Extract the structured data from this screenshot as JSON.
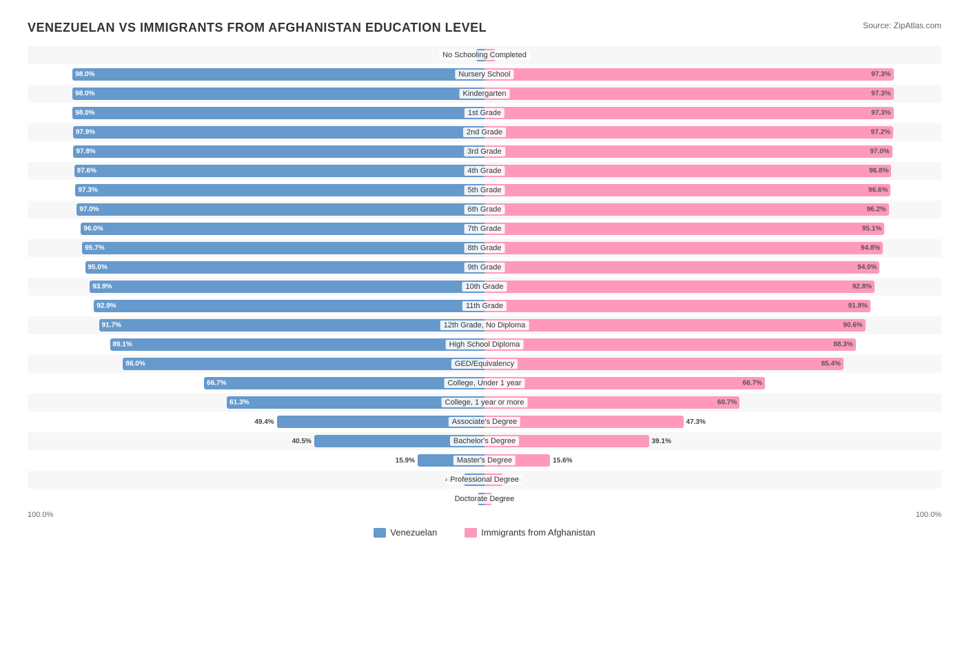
{
  "title": "VENEZUELAN VS IMMIGRANTS FROM AFGHANISTAN EDUCATION LEVEL",
  "source": "Source: ZipAtlas.com",
  "legend": {
    "blue_label": "Venezuelan",
    "pink_label": "Immigrants from Afghanistan"
  },
  "bottom_left": "100.0%",
  "bottom_right": "100.0%",
  "rows": [
    {
      "label": "No Schooling Completed",
      "left_val": "2.0%",
      "right_val": "2.7%",
      "left_pct": 2.0,
      "right_pct": 2.7,
      "left_inside": false,
      "right_inside": false
    },
    {
      "label": "Nursery School",
      "left_val": "98.0%",
      "right_val": "97.3%",
      "left_pct": 98.0,
      "right_pct": 97.3,
      "left_inside": true,
      "right_inside": true
    },
    {
      "label": "Kindergarten",
      "left_val": "98.0%",
      "right_val": "97.3%",
      "left_pct": 98.0,
      "right_pct": 97.3,
      "left_inside": true,
      "right_inside": true
    },
    {
      "label": "1st Grade",
      "left_val": "98.0%",
      "right_val": "97.3%",
      "left_pct": 98.0,
      "right_pct": 97.3,
      "left_inside": true,
      "right_inside": true
    },
    {
      "label": "2nd Grade",
      "left_val": "97.9%",
      "right_val": "97.2%",
      "left_pct": 97.9,
      "right_pct": 97.2,
      "left_inside": true,
      "right_inside": true
    },
    {
      "label": "3rd Grade",
      "left_val": "97.8%",
      "right_val": "97.0%",
      "left_pct": 97.8,
      "right_pct": 97.0,
      "left_inside": true,
      "right_inside": true
    },
    {
      "label": "4th Grade",
      "left_val": "97.6%",
      "right_val": "96.8%",
      "left_pct": 97.6,
      "right_pct": 96.8,
      "left_inside": true,
      "right_inside": true
    },
    {
      "label": "5th Grade",
      "left_val": "97.3%",
      "right_val": "96.6%",
      "left_pct": 97.3,
      "right_pct": 96.6,
      "left_inside": true,
      "right_inside": true
    },
    {
      "label": "6th Grade",
      "left_val": "97.0%",
      "right_val": "96.2%",
      "left_pct": 97.0,
      "right_pct": 96.2,
      "left_inside": true,
      "right_inside": true
    },
    {
      "label": "7th Grade",
      "left_val": "96.0%",
      "right_val": "95.1%",
      "left_pct": 96.0,
      "right_pct": 95.1,
      "left_inside": true,
      "right_inside": true
    },
    {
      "label": "8th Grade",
      "left_val": "95.7%",
      "right_val": "94.8%",
      "left_pct": 95.7,
      "right_pct": 94.8,
      "left_inside": true,
      "right_inside": true
    },
    {
      "label": "9th Grade",
      "left_val": "95.0%",
      "right_val": "94.0%",
      "left_pct": 95.0,
      "right_pct": 94.0,
      "left_inside": true,
      "right_inside": true
    },
    {
      "label": "10th Grade",
      "left_val": "93.9%",
      "right_val": "92.8%",
      "left_pct": 93.9,
      "right_pct": 92.8,
      "left_inside": true,
      "right_inside": true
    },
    {
      "label": "11th Grade",
      "left_val": "92.9%",
      "right_val": "91.8%",
      "left_pct": 92.9,
      "right_pct": 91.8,
      "left_inside": true,
      "right_inside": true
    },
    {
      "label": "12th Grade, No Diploma",
      "left_val": "91.7%",
      "right_val": "90.6%",
      "left_pct": 91.7,
      "right_pct": 90.6,
      "left_inside": true,
      "right_inside": true
    },
    {
      "label": "High School Diploma",
      "left_val": "89.1%",
      "right_val": "88.3%",
      "left_pct": 89.1,
      "right_pct": 88.3,
      "left_inside": true,
      "right_inside": true
    },
    {
      "label": "GED/Equivalency",
      "left_val": "86.0%",
      "right_val": "85.4%",
      "left_pct": 86.0,
      "right_pct": 85.4,
      "left_inside": true,
      "right_inside": true
    },
    {
      "label": "College, Under 1 year",
      "left_val": "66.7%",
      "right_val": "66.7%",
      "left_pct": 66.7,
      "right_pct": 66.7,
      "left_inside": true,
      "right_inside": true
    },
    {
      "label": "College, 1 year or more",
      "left_val": "61.3%",
      "right_val": "60.7%",
      "left_pct": 61.3,
      "right_pct": 60.7,
      "left_inside": true,
      "right_inside": true
    },
    {
      "label": "Associate's Degree",
      "left_val": "49.4%",
      "right_val": "47.3%",
      "left_pct": 49.4,
      "right_pct": 47.3,
      "left_inside": false,
      "right_inside": false
    },
    {
      "label": "Bachelor's Degree",
      "left_val": "40.5%",
      "right_val": "39.1%",
      "left_pct": 40.5,
      "right_pct": 39.1,
      "left_inside": false,
      "right_inside": false
    },
    {
      "label": "Master's Degree",
      "left_val": "15.9%",
      "right_val": "15.6%",
      "left_pct": 15.9,
      "right_pct": 15.6,
      "left_inside": false,
      "right_inside": false
    },
    {
      "label": "Professional Degree",
      "left_val": "4.9%",
      "right_val": "4.5%",
      "left_pct": 4.9,
      "right_pct": 4.5,
      "left_inside": false,
      "right_inside": false
    },
    {
      "label": "Doctorate Degree",
      "left_val": "1.7%",
      "right_val": "1.8%",
      "left_pct": 1.7,
      "right_pct": 1.8,
      "left_inside": false,
      "right_inside": false
    }
  ],
  "colors": {
    "blue": "#6699cc",
    "pink": "#ff99bb",
    "blue_text": "#ffffff",
    "right_text_outside": "#444444",
    "left_text_outside": "#444444"
  }
}
